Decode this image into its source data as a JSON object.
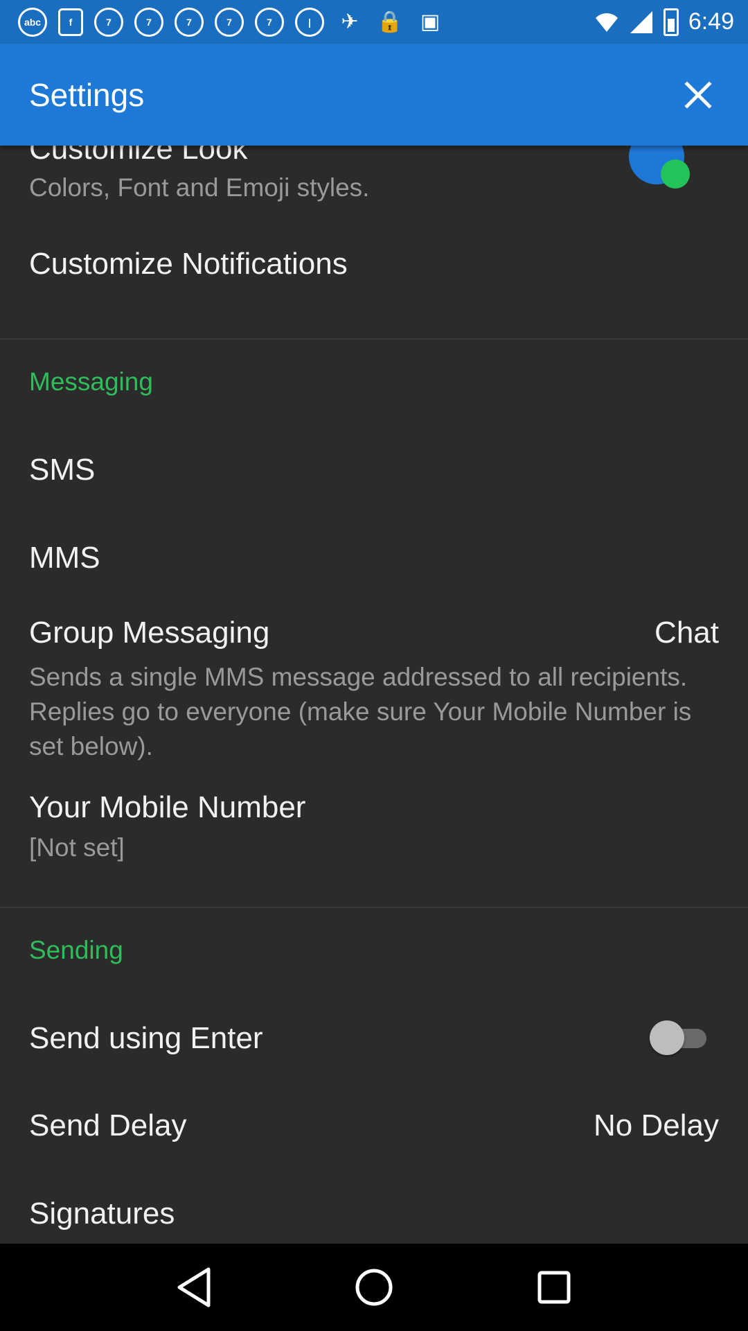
{
  "status_bar": {
    "time": "6:49",
    "icons": [
      "abc-news-icon",
      "facebook-icon",
      "abc7-icon",
      "abc7-icon",
      "abc7-icon",
      "abc7-icon",
      "abc7-icon",
      "circle-icon",
      "fake-gps-icon",
      "lock-icon",
      "android-icon"
    ]
  },
  "app_bar": {
    "title": "Settings"
  },
  "general": {
    "customize_look_title": "Customize Look",
    "customize_look_sub": "Colors, Font and Emoji styles.",
    "customize_notifications": "Customize Notifications"
  },
  "messaging": {
    "header": "Messaging",
    "sms": "SMS",
    "mms": "MMS",
    "group_title": "Group Messaging",
    "group_value": "Chat",
    "group_sub": "Sends a single MMS message addressed to all recipients. Replies go to everyone (make sure Your Mobile Number is set below).",
    "mobile_title": "Your Mobile Number",
    "mobile_sub": "[Not set]"
  },
  "sending": {
    "header": "Sending",
    "send_enter": "Send using Enter",
    "send_enter_on": false,
    "send_delay": "Send Delay",
    "send_delay_value": "No Delay",
    "signatures": "Signatures"
  },
  "colors": {
    "status_bar": "#1a6ec0",
    "app_bar": "#1e78d6",
    "section_header": "#2fbd5a",
    "background": "#2b2b2b"
  }
}
